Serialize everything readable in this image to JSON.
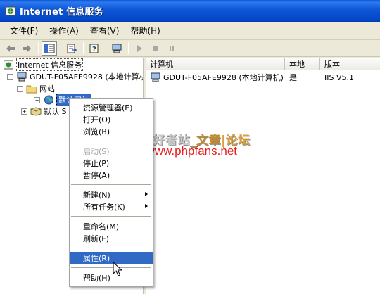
{
  "window": {
    "title": "Internet 信息服务",
    "icon": "iis-icon"
  },
  "menubar": {
    "items": [
      "文件(F)",
      "操作(A)",
      "查看(V)",
      "帮助(H)"
    ]
  },
  "toolbar": {
    "buttons": [
      "back-icon",
      "forward-icon",
      "show-hide-tree-icon",
      "export-list-icon",
      "help-icon",
      "computer-icon",
      "start-icon",
      "stop-icon",
      "pause-icon"
    ]
  },
  "tree": {
    "root": "Internet 信息服务",
    "computer": "GDUT-F05AFE9928 (本地计算机",
    "websites": "网站",
    "default_site": "默认网站",
    "default_smtp": "默认 S"
  },
  "list": {
    "columns": [
      "计算机",
      "本地",
      "版本"
    ],
    "rows": [
      {
        "computer": "GDUT-F05AFE9928 (本地计算机)",
        "local": "是",
        "version": "IIS V5.1"
      }
    ]
  },
  "context_menu": {
    "group1": [
      "资源管理器(E)",
      "打开(O)",
      "浏览(B)"
    ],
    "group2": [
      "启动(S)",
      "停止(P)",
      "暂停(A)"
    ],
    "group3": [
      "新建(N)",
      "所有任务(K)"
    ],
    "group4": [
      "重命名(M)",
      "刷新(F)"
    ],
    "group5": [
      "属性(R)"
    ],
    "group6": [
      "帮助(H)"
    ],
    "highlighted": "属性(R)",
    "disabled": [
      "启动(S)"
    ]
  },
  "watermark": {
    "line1_a": "php爱好者站",
    "line1_b": "_文章",
    "line1_c": "|论坛",
    "line2": "http://www.phpfans.net"
  },
  "colors": {
    "titlebar": "#0a5ad8",
    "selection": "#316ac5",
    "watermark_url": "#e81e1e"
  }
}
